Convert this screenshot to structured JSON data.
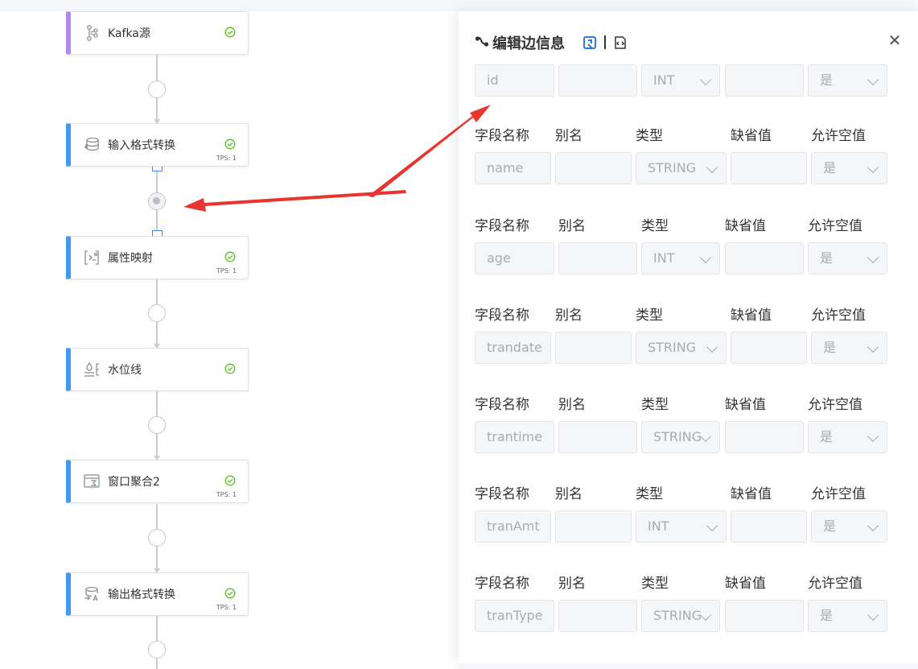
{
  "flow": {
    "nodes": [
      {
        "label": "Kafka源",
        "icon": "kafka-branch-icon",
        "tps": ""
      },
      {
        "label": "输入格式转换",
        "icon": "database-convert-icon",
        "tps": "TPS: 1"
      },
      {
        "label": "属性映射",
        "icon": "attribute-mapping-icon",
        "tps": "TPS: 1"
      },
      {
        "label": "水位线",
        "icon": "water-level-icon",
        "tps": ""
      },
      {
        "label": "窗口聚合2",
        "icon": "window-aggregate-icon",
        "tps": "TPS: 1"
      },
      {
        "label": "输出格式转换",
        "icon": "output-convert-icon",
        "tps": "TPS: 1"
      }
    ],
    "status_icon": "success-check-icon",
    "colors": {
      "accent": "#4098f7",
      "kafka": "#b08ce8",
      "success": "#52c41a",
      "annotation": "#e8352f"
    }
  },
  "panel": {
    "title": "编辑边信息",
    "title_icon": "edge-icon",
    "action_icons": [
      "refresh-edit-icon",
      "code-file-icon"
    ],
    "headers": {
      "name": "字段名称",
      "alias": "别名",
      "type": "类型",
      "default": "缺省值",
      "nullable": "允许空值"
    },
    "rows": [
      {
        "name": "id",
        "alias": "",
        "type": "INT",
        "default": "",
        "nullable": "是"
      },
      {
        "name": "name",
        "alias": "",
        "type": "STRING",
        "default": "",
        "nullable": "是"
      },
      {
        "name": "age",
        "alias": "",
        "type": "INT",
        "default": "",
        "nullable": "是"
      },
      {
        "name": "trandate",
        "alias": "",
        "type": "STRING",
        "default": "",
        "nullable": "是"
      },
      {
        "name": "trantime",
        "alias": "",
        "type": "STRING",
        "default": "",
        "nullable": "是"
      },
      {
        "name": "tranAmt",
        "alias": "",
        "type": "INT",
        "default": "",
        "nullable": "是"
      },
      {
        "name": "tranType",
        "alias": "",
        "type": "STRING",
        "default": "",
        "nullable": "是"
      }
    ]
  }
}
